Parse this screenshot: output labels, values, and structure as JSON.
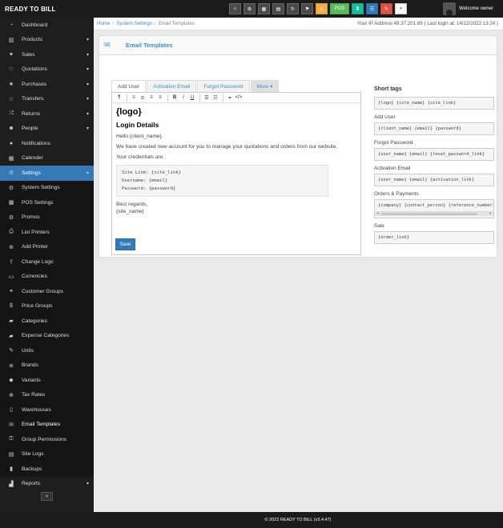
{
  "brand": "READY TO BILL",
  "topbar": {
    "icons": [
      "home-icon",
      "gear-icon",
      "calculator-icon",
      "calendar-icon",
      "refresh-icon",
      "flag-icon",
      "warning-icon",
      "pos-icon",
      "hourglass-icon",
      "list-icon",
      "tag-icon",
      "menu-icon"
    ],
    "pos_label": "POS",
    "welcome": "Welcome owner"
  },
  "sidebar": {
    "items": [
      {
        "label": "Dashboard",
        "icon": "dashboard-icon",
        "chevron": false
      },
      {
        "label": "Products",
        "icon": "barcode-icon",
        "chevron": true
      },
      {
        "label": "Sales",
        "icon": "heart-icon",
        "chevron": true
      },
      {
        "label": "Quotations",
        "icon": "heart-outline-icon",
        "chevron": true
      },
      {
        "label": "Purchases",
        "icon": "star-icon",
        "chevron": true
      },
      {
        "label": "Transfers",
        "icon": "star-outline-icon",
        "chevron": true
      },
      {
        "label": "Returns",
        "icon": "random-icon",
        "chevron": true
      },
      {
        "label": "People",
        "icon": "users-icon",
        "chevron": true
      },
      {
        "label": "Notifications",
        "icon": "info-icon",
        "chevron": false
      },
      {
        "label": "Calender",
        "icon": "calendar-icon",
        "chevron": false
      },
      {
        "label": "Settings",
        "icon": "cog-icon",
        "chevron": true,
        "state": "active"
      },
      {
        "label": "System Settings",
        "icon": "cogs-icon",
        "sub": true
      },
      {
        "label": "POS Settings",
        "icon": "th-icon",
        "sub": true
      },
      {
        "label": "Promos",
        "icon": "cogs-icon",
        "sub": true
      },
      {
        "label": "List Printers",
        "icon": "print-icon",
        "sub": true
      },
      {
        "label": "Add Printer",
        "icon": "plus-circle-icon",
        "sub": true
      },
      {
        "label": "Change Logo",
        "icon": "upload-icon",
        "sub": true
      },
      {
        "label": "Currencies",
        "icon": "money-icon",
        "sub": true
      },
      {
        "label": "Customer Groups",
        "icon": "chain-icon",
        "sub": true
      },
      {
        "label": "Price Groups",
        "icon": "dollar-icon",
        "sub": true
      },
      {
        "label": "Categories",
        "icon": "folder-open-icon",
        "sub": true
      },
      {
        "label": "Expense Categories",
        "icon": "folder-open-icon",
        "sub": true
      },
      {
        "label": "Units",
        "icon": "wrench-icon",
        "sub": true
      },
      {
        "label": "Brands",
        "icon": "th-list-icon",
        "sub": true
      },
      {
        "label": "Variants",
        "icon": "tags-icon",
        "sub": true
      },
      {
        "label": "Tax Rates",
        "icon": "plus-circle-icon",
        "sub": true
      },
      {
        "label": "Warehouses",
        "icon": "building-icon",
        "sub": true
      },
      {
        "label": "Email Templates",
        "icon": "envelope-icon",
        "sub": true,
        "state": "selected"
      },
      {
        "label": "Group Permissions",
        "icon": "key-icon",
        "sub": true
      },
      {
        "label": "Site Logs",
        "icon": "file-text-icon",
        "sub": true
      },
      {
        "label": "Backups",
        "icon": "database-icon",
        "sub": true
      },
      {
        "label": "Reports",
        "icon": "bar-chart-icon",
        "chevron": true
      }
    ],
    "collapse_icon": "double-left-icon"
  },
  "breadcrumb": {
    "home": "Home",
    "sep": "/",
    "parent": "System Settings",
    "current": "Email Templates"
  },
  "ip_info": "Your IP Address 49.37.201.89 ( Last login at: 14/12/2022 13:24 )",
  "panel": {
    "title": "Email Templates",
    "icon": "envelope-icon"
  },
  "tabs": [
    {
      "label": "Add User",
      "active": true
    },
    {
      "label": "Activation Email",
      "active": false
    },
    {
      "label": "Forgot Password",
      "active": false
    },
    {
      "label": "More ▾",
      "active": false
    }
  ],
  "editor": {
    "toolbar": [
      "¶",
      "≡",
      "⊙",
      "≡",
      "≡",
      "B",
      "I",
      "U",
      "☰",
      "☷",
      "⚭",
      "</>"
    ],
    "logo": "{logo}",
    "heading": "Login Details",
    "greeting": "Hello {client_name},",
    "intro": "We have created new account for you to manage your quotations and orders from our website.",
    "credentials_label": "Your credentials are :",
    "code_lines": [
      "Site Link: {site_link}",
      "Username: {email}",
      "Password: {password}"
    ],
    "regards": "Best regards,",
    "signature": "{site_name}"
  },
  "save_label": "Save",
  "short_tags": {
    "title": "Short tags",
    "groups": [
      {
        "label": "",
        "tags": "{logo} {site_name} {site_link}"
      },
      {
        "label": "Add User",
        "tags": "{client_name} {email} {password}"
      },
      {
        "label": "Forgot Password",
        "tags": "{user_name} {email} {reset_password_link}"
      },
      {
        "label": "Activation Email",
        "tags": "{user_name} {email} {activation_link}"
      },
      {
        "label": "Orders & Payments",
        "tags": "{company} {contact_person} {reference_number} {"
      },
      {
        "label": "Sale",
        "tags": "{order_link}"
      }
    ]
  },
  "footer": "© 2022 READY TO BILL (v3.4.47)"
}
